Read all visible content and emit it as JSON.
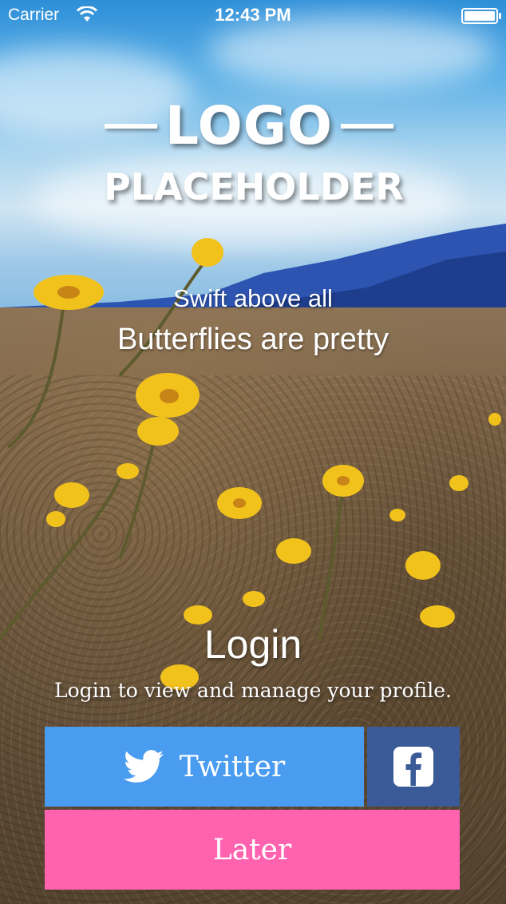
{
  "status_bar": {
    "carrier": "Carrier",
    "time": "12:43 PM",
    "wifi_icon": "wifi-icon",
    "battery_icon": "battery-icon"
  },
  "logo": {
    "line1": "LOGO",
    "line2": "PLACEHOLDER"
  },
  "tagline": {
    "primary": "Swift above all",
    "secondary": "Butterflies are pretty"
  },
  "login": {
    "title": "Login",
    "subtitle": "Login to view and manage your profile."
  },
  "buttons": {
    "twitter_label": "Twitter",
    "twitter_icon": "twitter-bird-icon",
    "facebook_icon": "facebook-icon",
    "later_label": "Later"
  },
  "colors": {
    "twitter": "#4a9cf0",
    "facebook": "#3b5a98",
    "later": "#ff63b0"
  }
}
